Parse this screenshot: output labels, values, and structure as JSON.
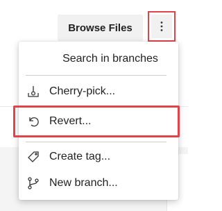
{
  "toolbar": {
    "browse_files_label": "Browse Files",
    "more_icon": "more-vertical-icon"
  },
  "menu": {
    "header": "Search in branches",
    "items": [
      {
        "label": "Cherry-pick...",
        "icon": "cherry-pick-icon"
      },
      {
        "label": "Revert...",
        "icon": "revert-icon"
      },
      {
        "label": "Create tag...",
        "icon": "tag-icon"
      },
      {
        "label": "New branch...",
        "icon": "branch-icon"
      }
    ]
  },
  "colors": {
    "highlight": "#e0444a",
    "button_bg": "#f1f1f1"
  }
}
